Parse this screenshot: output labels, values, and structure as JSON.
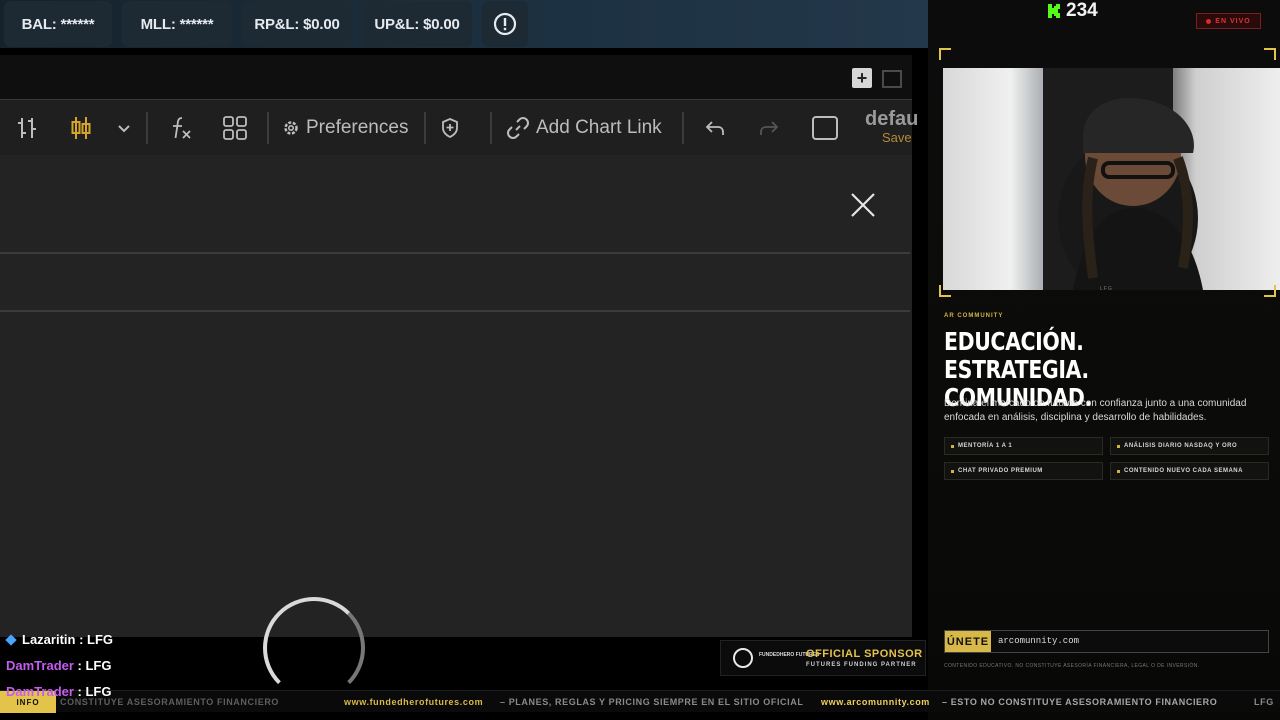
{
  "stats": {
    "balance": "BAL: ******",
    "mll": "MLL: ******",
    "rpl": "RP&L: $0.00",
    "upl": "UP&L: $0.00"
  },
  "toolbar": {
    "preferences": "Preferences",
    "add_chart_link": "Add Chart Link",
    "default_label": "defau",
    "save_label": "Save"
  },
  "stream": {
    "viewer_count": "234",
    "live_label": "EN VIVO",
    "cam_label": "LFG"
  },
  "ar": {
    "kicker": "AR COMMUNITY",
    "title_line1": "EDUCACIÓN. ESTRATEGIA.",
    "title_line2": "COMUNIDAD.",
    "description": "Domina el mercado de futuros con confianza junto a una comunidad enfocada en análisis, disciplina y desarrollo de habilidades.",
    "features": [
      "MENTORÍA 1 A 1",
      "ANÁLISIS DIARIO NASDAQ Y ORO",
      "CHAT PRIVADO PREMIUM",
      "CONTENIDO NUEVO CADA SEMANA"
    ],
    "join_label": "ÚNETE",
    "join_url": "arcomunnity.com",
    "disclaimer": "CONTENIDO EDUCATIVO. NO CONSTITUYE ASESORÍA FINANCIERA, LEGAL O DE INVERSIÓN."
  },
  "chat": [
    {
      "user": "Lazaritin",
      "sep": " : ",
      "msg": "LFG",
      "color": "#ffffff"
    },
    {
      "user": "DamTrader",
      "sep": " : ",
      "msg": "LFG",
      "color": "#c45cf0"
    },
    {
      "user": "DamTrader",
      "sep": " : ",
      "msg": "LFG",
      "color": "#c45cf0"
    }
  ],
  "sponsor": {
    "brand": "FUNDEDHERO FUTURES",
    "title": "OFFICIAL SPONSOR",
    "subtitle": "FUTURES FUNDING PARTNER"
  },
  "ticker": {
    "info": "INFO",
    "item1": "CONSTITUYE ASESORAMIENTO FINANCIERO",
    "item2_url": "www.fundedherofutures.com",
    "item2_text": "–  PLANES, REGLAS Y PRICING SIEMPRE EN EL SITIO OFICIAL",
    "item3_url": "www.arcomunnity.com",
    "item3_text": "–  ESTO NO CONSTITUYE ASESORAMIENTO FINANCIERO",
    "item4": "LFG"
  },
  "colors": {
    "accent_gold": "#e3c34a",
    "live_red": "#e02a2a",
    "kick_green": "#53fc18"
  }
}
